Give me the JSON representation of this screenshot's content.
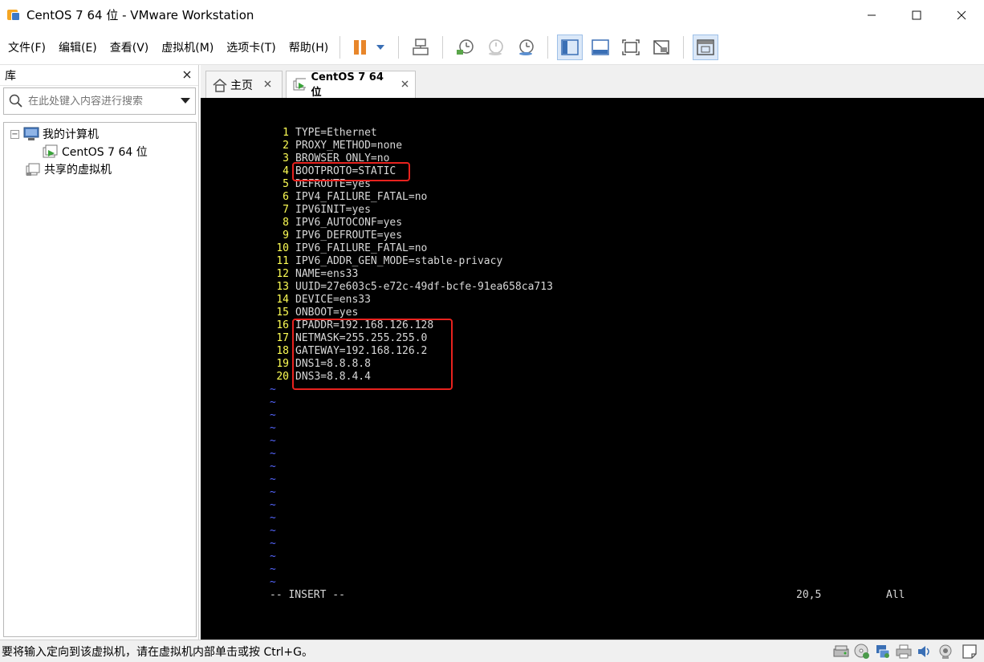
{
  "window": {
    "title": "CentOS 7 64 位 - VMware Workstation"
  },
  "menu": {
    "items": [
      "文件(F)",
      "编辑(E)",
      "查看(V)",
      "虚拟机(M)",
      "选项卡(T)",
      "帮助(H)"
    ]
  },
  "library": {
    "title": "库",
    "search_placeholder": "在此处键入内容进行搜索",
    "tree": {
      "my_computer": "我的计算机",
      "vm": "CentOS 7 64 位",
      "shared": "共享的虚拟机"
    }
  },
  "tabs": [
    {
      "label": "主页"
    },
    {
      "label": "CentOS 7 64 位"
    }
  ],
  "terminal": {
    "lines": [
      {
        "n": "1",
        "text": "TYPE=Ethernet"
      },
      {
        "n": "2",
        "text": "PROXY_METHOD=none"
      },
      {
        "n": "3",
        "text": "BROWSER_ONLY=no"
      },
      {
        "n": "4",
        "text": "BOOTPROTO=STATIC"
      },
      {
        "n": "5",
        "text": "DEFROUTE=yes"
      },
      {
        "n": "6",
        "text": "IPV4_FAILURE_FATAL=no"
      },
      {
        "n": "7",
        "text": "IPV6INIT=yes"
      },
      {
        "n": "8",
        "text": "IPV6_AUTOCONF=yes"
      },
      {
        "n": "9",
        "text": "IPV6_DEFROUTE=yes"
      },
      {
        "n": "10",
        "text": "IPV6_FAILURE_FATAL=no"
      },
      {
        "n": "11",
        "text": "IPV6_ADDR_GEN_MODE=stable-privacy"
      },
      {
        "n": "12",
        "text": "NAME=ens33"
      },
      {
        "n": "13",
        "text": "UUID=27e603c5-e72c-49df-bcfe-91ea658ca713"
      },
      {
        "n": "14",
        "text": "DEVICE=ens33"
      },
      {
        "n": "15",
        "text": "ONBOOT=yes"
      },
      {
        "n": "16",
        "text": "IPADDR=192.168.126.128"
      },
      {
        "n": "17",
        "text": "NETMASK=255.255.255.0"
      },
      {
        "n": "18",
        "text": "GATEWAY=192.168.126.2"
      },
      {
        "n": "19",
        "text": "DNS1=8.8.8.8"
      },
      {
        "n": "20",
        "text": "DNS3=8.8.4.4"
      }
    ],
    "tilde": "~",
    "mode": "-- INSERT --",
    "position": "20,5",
    "scroll": "All"
  },
  "statusbar": {
    "message": "要将输入定向到该虚拟机，请在虚拟机内部单击或按 Ctrl+G。"
  },
  "colors": {
    "highlight": "#e8221e",
    "line_number": "#ffff55",
    "tilde": "#5566ff"
  }
}
